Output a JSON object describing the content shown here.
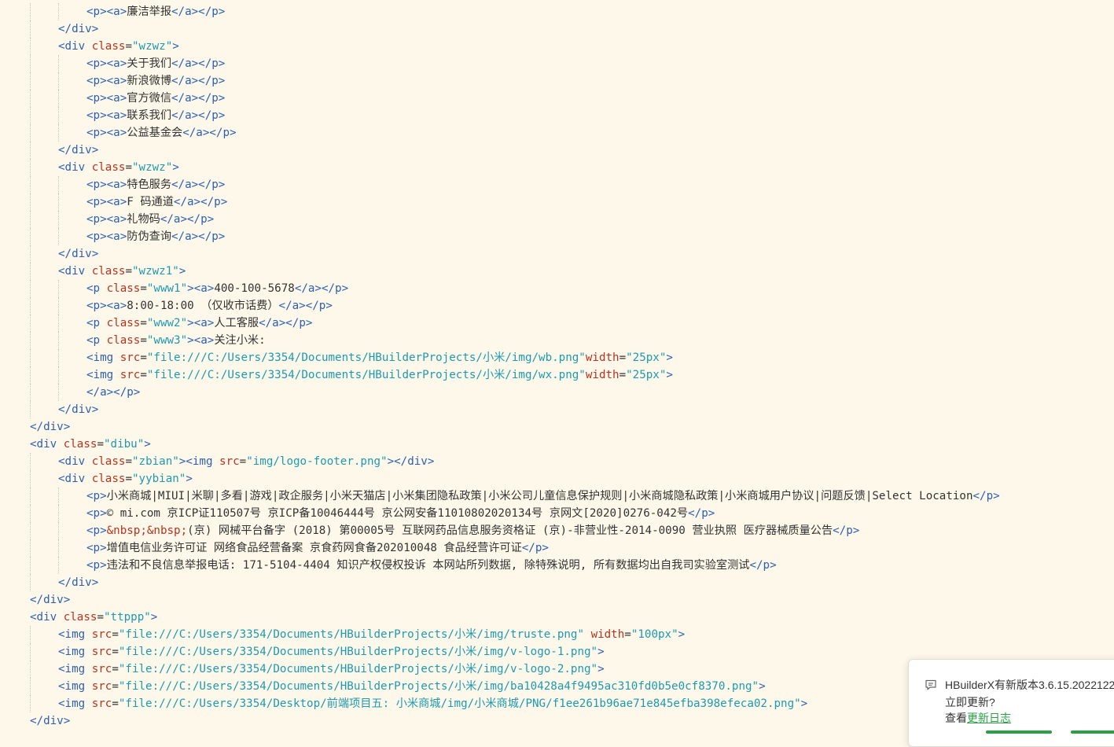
{
  "editor": {
    "lines": [
      {
        "indent": 2,
        "tokens": [
          [
            "tag",
            "<p><a>"
          ],
          [
            "text",
            "廉洁举报"
          ],
          [
            "tag",
            "</a></p>"
          ]
        ]
      },
      {
        "indent": 1,
        "tokens": [
          [
            "tag",
            "</div>"
          ]
        ]
      },
      {
        "indent": 1,
        "tokens": [
          [
            "tag",
            "<div "
          ],
          [
            "attr",
            "class"
          ],
          [
            "eq",
            "="
          ],
          [
            "str",
            "\"wzwz\""
          ],
          [
            "tag",
            ">"
          ]
        ]
      },
      {
        "indent": 2,
        "tokens": [
          [
            "tag",
            "<p><a>"
          ],
          [
            "text",
            "关于我们"
          ],
          [
            "tag",
            "</a></p>"
          ]
        ]
      },
      {
        "indent": 2,
        "tokens": [
          [
            "tag",
            "<p><a>"
          ],
          [
            "text",
            "新浪微博"
          ],
          [
            "tag",
            "</a></p>"
          ]
        ]
      },
      {
        "indent": 2,
        "tokens": [
          [
            "tag",
            "<p><a>"
          ],
          [
            "text",
            "官方微信"
          ],
          [
            "tag",
            "</a></p>"
          ]
        ]
      },
      {
        "indent": 2,
        "tokens": [
          [
            "tag",
            "<p><a>"
          ],
          [
            "text",
            "联系我们"
          ],
          [
            "tag",
            "</a></p>"
          ]
        ]
      },
      {
        "indent": 2,
        "tokens": [
          [
            "tag",
            "<p><a>"
          ],
          [
            "text",
            "公益基金会"
          ],
          [
            "tag",
            "</a></p>"
          ]
        ]
      },
      {
        "indent": 1,
        "tokens": [
          [
            "tag",
            "</div>"
          ]
        ]
      },
      {
        "indent": 1,
        "tokens": [
          [
            "tag",
            "<div "
          ],
          [
            "attr",
            "class"
          ],
          [
            "eq",
            "="
          ],
          [
            "str",
            "\"wzwz\""
          ],
          [
            "tag",
            ">"
          ]
        ]
      },
      {
        "indent": 2,
        "tokens": [
          [
            "tag",
            "<p><a>"
          ],
          [
            "text",
            "特色服务"
          ],
          [
            "tag",
            "</a></p>"
          ]
        ]
      },
      {
        "indent": 2,
        "tokens": [
          [
            "tag",
            "<p><a>"
          ],
          [
            "text",
            "F 码通道"
          ],
          [
            "tag",
            "</a></p>"
          ]
        ]
      },
      {
        "indent": 2,
        "tokens": [
          [
            "tag",
            "<p><a>"
          ],
          [
            "text",
            "礼物码"
          ],
          [
            "tag",
            "</a></p>"
          ]
        ]
      },
      {
        "indent": 2,
        "tokens": [
          [
            "tag",
            "<p><a>"
          ],
          [
            "text",
            "防伪查询"
          ],
          [
            "tag",
            "</a></p>"
          ]
        ]
      },
      {
        "indent": 1,
        "tokens": [
          [
            "tag",
            "</div>"
          ]
        ]
      },
      {
        "indent": 1,
        "tokens": [
          [
            "tag",
            "<div "
          ],
          [
            "attr",
            "class"
          ],
          [
            "eq",
            "="
          ],
          [
            "str",
            "\"wzwz1\""
          ],
          [
            "tag",
            ">"
          ]
        ]
      },
      {
        "indent": 2,
        "tokens": [
          [
            "tag",
            "<p "
          ],
          [
            "attr",
            "class"
          ],
          [
            "eq",
            "="
          ],
          [
            "str",
            "\"www1\""
          ],
          [
            "tag",
            ">"
          ],
          [
            "tag",
            "<a>"
          ],
          [
            "text",
            "400-100-5678"
          ],
          [
            "tag",
            "</a></p>"
          ]
        ]
      },
      {
        "indent": 2,
        "tokens": [
          [
            "tag",
            "<p><a>"
          ],
          [
            "text",
            "8:00-18:00 （仅收市话费）"
          ],
          [
            "tag",
            "</a></p>"
          ]
        ]
      },
      {
        "indent": 2,
        "tokens": [
          [
            "tag",
            "<p "
          ],
          [
            "attr",
            "class"
          ],
          [
            "eq",
            "="
          ],
          [
            "str",
            "\"www2\""
          ],
          [
            "tag",
            ">"
          ],
          [
            "tag",
            "<a>"
          ],
          [
            "text",
            "人工客服"
          ],
          [
            "tag",
            "</a></p>"
          ]
        ]
      },
      {
        "indent": 2,
        "tokens": [
          [
            "tag",
            "<p "
          ],
          [
            "attr",
            "class"
          ],
          [
            "eq",
            "="
          ],
          [
            "str",
            "\"www3\""
          ],
          [
            "tag",
            ">"
          ],
          [
            "tag",
            "<a>"
          ],
          [
            "text",
            "关注小米:"
          ]
        ]
      },
      {
        "indent": 2,
        "tokens": [
          [
            "tag",
            "<img "
          ],
          [
            "attr",
            "src"
          ],
          [
            "eq",
            "="
          ],
          [
            "str",
            "\"file:///C:/Users/3354/Documents/HBuilderProjects/小米/img/wb.png\""
          ],
          [
            "attr",
            "width"
          ],
          [
            "eq",
            "="
          ],
          [
            "str",
            "\"25px\""
          ],
          [
            "tag",
            ">"
          ]
        ]
      },
      {
        "indent": 2,
        "tokens": [
          [
            "tag",
            "<img "
          ],
          [
            "attr",
            "src"
          ],
          [
            "eq",
            "="
          ],
          [
            "str",
            "\"file:///C:/Users/3354/Documents/HBuilderProjects/小米/img/wx.png\""
          ],
          [
            "attr",
            "width"
          ],
          [
            "eq",
            "="
          ],
          [
            "str",
            "\"25px\""
          ],
          [
            "tag",
            ">"
          ]
        ]
      },
      {
        "indent": 2,
        "tokens": [
          [
            "tag",
            "</a></p>"
          ]
        ]
      },
      {
        "indent": 1,
        "tokens": [
          [
            "tag",
            "</div>"
          ]
        ]
      },
      {
        "indent": 0,
        "tokens": [
          [
            "tag",
            "</div>"
          ]
        ]
      },
      {
        "indent": 0,
        "tokens": [
          [
            "tag",
            "<div "
          ],
          [
            "attr",
            "class"
          ],
          [
            "eq",
            "="
          ],
          [
            "str",
            "\"dibu\""
          ],
          [
            "tag",
            ">"
          ]
        ]
      },
      {
        "indent": 1,
        "tokens": [
          [
            "tag",
            "<div "
          ],
          [
            "attr",
            "class"
          ],
          [
            "eq",
            "="
          ],
          [
            "str",
            "\"zbian\""
          ],
          [
            "tag",
            "><img "
          ],
          [
            "attr",
            "src"
          ],
          [
            "eq",
            "="
          ],
          [
            "str",
            "\"img/logo-footer.png\""
          ],
          [
            "tag",
            "></div>"
          ]
        ]
      },
      {
        "indent": 1,
        "tokens": [
          [
            "tag",
            "<div "
          ],
          [
            "attr",
            "class"
          ],
          [
            "eq",
            "="
          ],
          [
            "str",
            "\"yybian\""
          ],
          [
            "tag",
            ">"
          ]
        ]
      },
      {
        "indent": 2,
        "tokens": [
          [
            "tag",
            "<p>"
          ],
          [
            "text",
            "小米商城|MIUI|米聊|多看|游戏|政企服务|小米天猫店|小米集团隐私政策|小米公司儿童信息保护规则|小米商城隐私政策|小米商城用户协议|问题反馈|Select Location"
          ],
          [
            "tag",
            "</p>"
          ]
        ]
      },
      {
        "indent": 2,
        "tokens": [
          [
            "tag",
            "<p>"
          ],
          [
            "text",
            "© mi.com 京ICP证110507号 京ICP备10046444号 京公网安备11010802020134号 京网文[2020]0276-042号"
          ],
          [
            "tag",
            "</p>"
          ]
        ]
      },
      {
        "indent": 2,
        "tokens": [
          [
            "tag",
            "<p>"
          ],
          [
            "attr",
            "&nbsp;&nbsp;"
          ],
          [
            "text",
            "(京) 网械平台备字 (2018) 第00005号 互联网药品信息服务资格证 (京)-非营业性-2014-0090 营业执照 医疗器械质量公告"
          ],
          [
            "tag",
            "</p>"
          ]
        ]
      },
      {
        "indent": 2,
        "tokens": [
          [
            "tag",
            "<p>"
          ],
          [
            "text",
            "增值电信业务许可证 网络食品经营备案 京食药网食备202010048 食品经营许可证"
          ],
          [
            "tag",
            "</p>"
          ]
        ]
      },
      {
        "indent": 2,
        "tokens": [
          [
            "tag",
            "<p>"
          ],
          [
            "text",
            "违法和不良信息举报电话: 171-5104-4404 知识产权侵权投诉 本网站所列数据, 除特殊说明, 所有数据均出自我司实验室测试"
          ],
          [
            "tag",
            "</p>"
          ]
        ]
      },
      {
        "indent": 1,
        "tokens": [
          [
            "tag",
            "</div>"
          ]
        ]
      },
      {
        "indent": 0,
        "tokens": [
          [
            "tag",
            "</div>"
          ]
        ]
      },
      {
        "indent": 0,
        "tokens": [
          [
            "tag",
            "<div "
          ],
          [
            "attr",
            "class"
          ],
          [
            "eq",
            "="
          ],
          [
            "str",
            "\"ttppp\""
          ],
          [
            "tag",
            ">"
          ]
        ]
      },
      {
        "indent": 1,
        "tokens": [
          [
            "tag",
            "<img "
          ],
          [
            "attr",
            "src"
          ],
          [
            "eq",
            "="
          ],
          [
            "str",
            "\"file:///C:/Users/3354/Documents/HBuilderProjects/小米/img/truste.png\" "
          ],
          [
            "attr",
            "width"
          ],
          [
            "eq",
            "="
          ],
          [
            "str",
            "\"100px\""
          ],
          [
            "tag",
            ">"
          ]
        ]
      },
      {
        "indent": 1,
        "tokens": [
          [
            "tag",
            "<img "
          ],
          [
            "attr",
            "src"
          ],
          [
            "eq",
            "="
          ],
          [
            "str",
            "\"file:///C:/Users/3354/Documents/HBuilderProjects/小米/img/v-logo-1.png\""
          ],
          [
            "tag",
            ">"
          ]
        ]
      },
      {
        "indent": 1,
        "tokens": [
          [
            "tag",
            "<img "
          ],
          [
            "attr",
            "src"
          ],
          [
            "eq",
            "="
          ],
          [
            "str",
            "\"file:///C:/Users/3354/Documents/HBuilderProjects/小米/img/v-logo-2.png\""
          ],
          [
            "tag",
            ">"
          ]
        ]
      },
      {
        "indent": 1,
        "tokens": [
          [
            "tag",
            "<img "
          ],
          [
            "attr",
            "src"
          ],
          [
            "eq",
            "="
          ],
          [
            "str",
            "\"file:///C:/Users/3354/Documents/HBuilderProjects/小米/img/ba10428a4f9495ac310fd0b5e0cf8370.png\""
          ],
          [
            "tag",
            ">"
          ]
        ]
      },
      {
        "indent": 1,
        "tokens": [
          [
            "tag",
            "<img "
          ],
          [
            "attr",
            "src"
          ],
          [
            "eq",
            "="
          ],
          [
            "str",
            "\"file:///C:/Users/3354/Desktop/前端项目五: 小米商城/img/小米商城/PNG/f1ee261b96ae71e845efba398efeca02.png\""
          ],
          [
            "tag",
            ">"
          ]
        ]
      },
      {
        "indent": 0,
        "tokens": [
          [
            "tag",
            "</div>"
          ]
        ]
      }
    ]
  },
  "notification": {
    "title": "HBuilderX有新版本3.6.15.2022122",
    "question": "立即更新?",
    "view_prefix": "查看",
    "changelog_link": "更新日志"
  }
}
